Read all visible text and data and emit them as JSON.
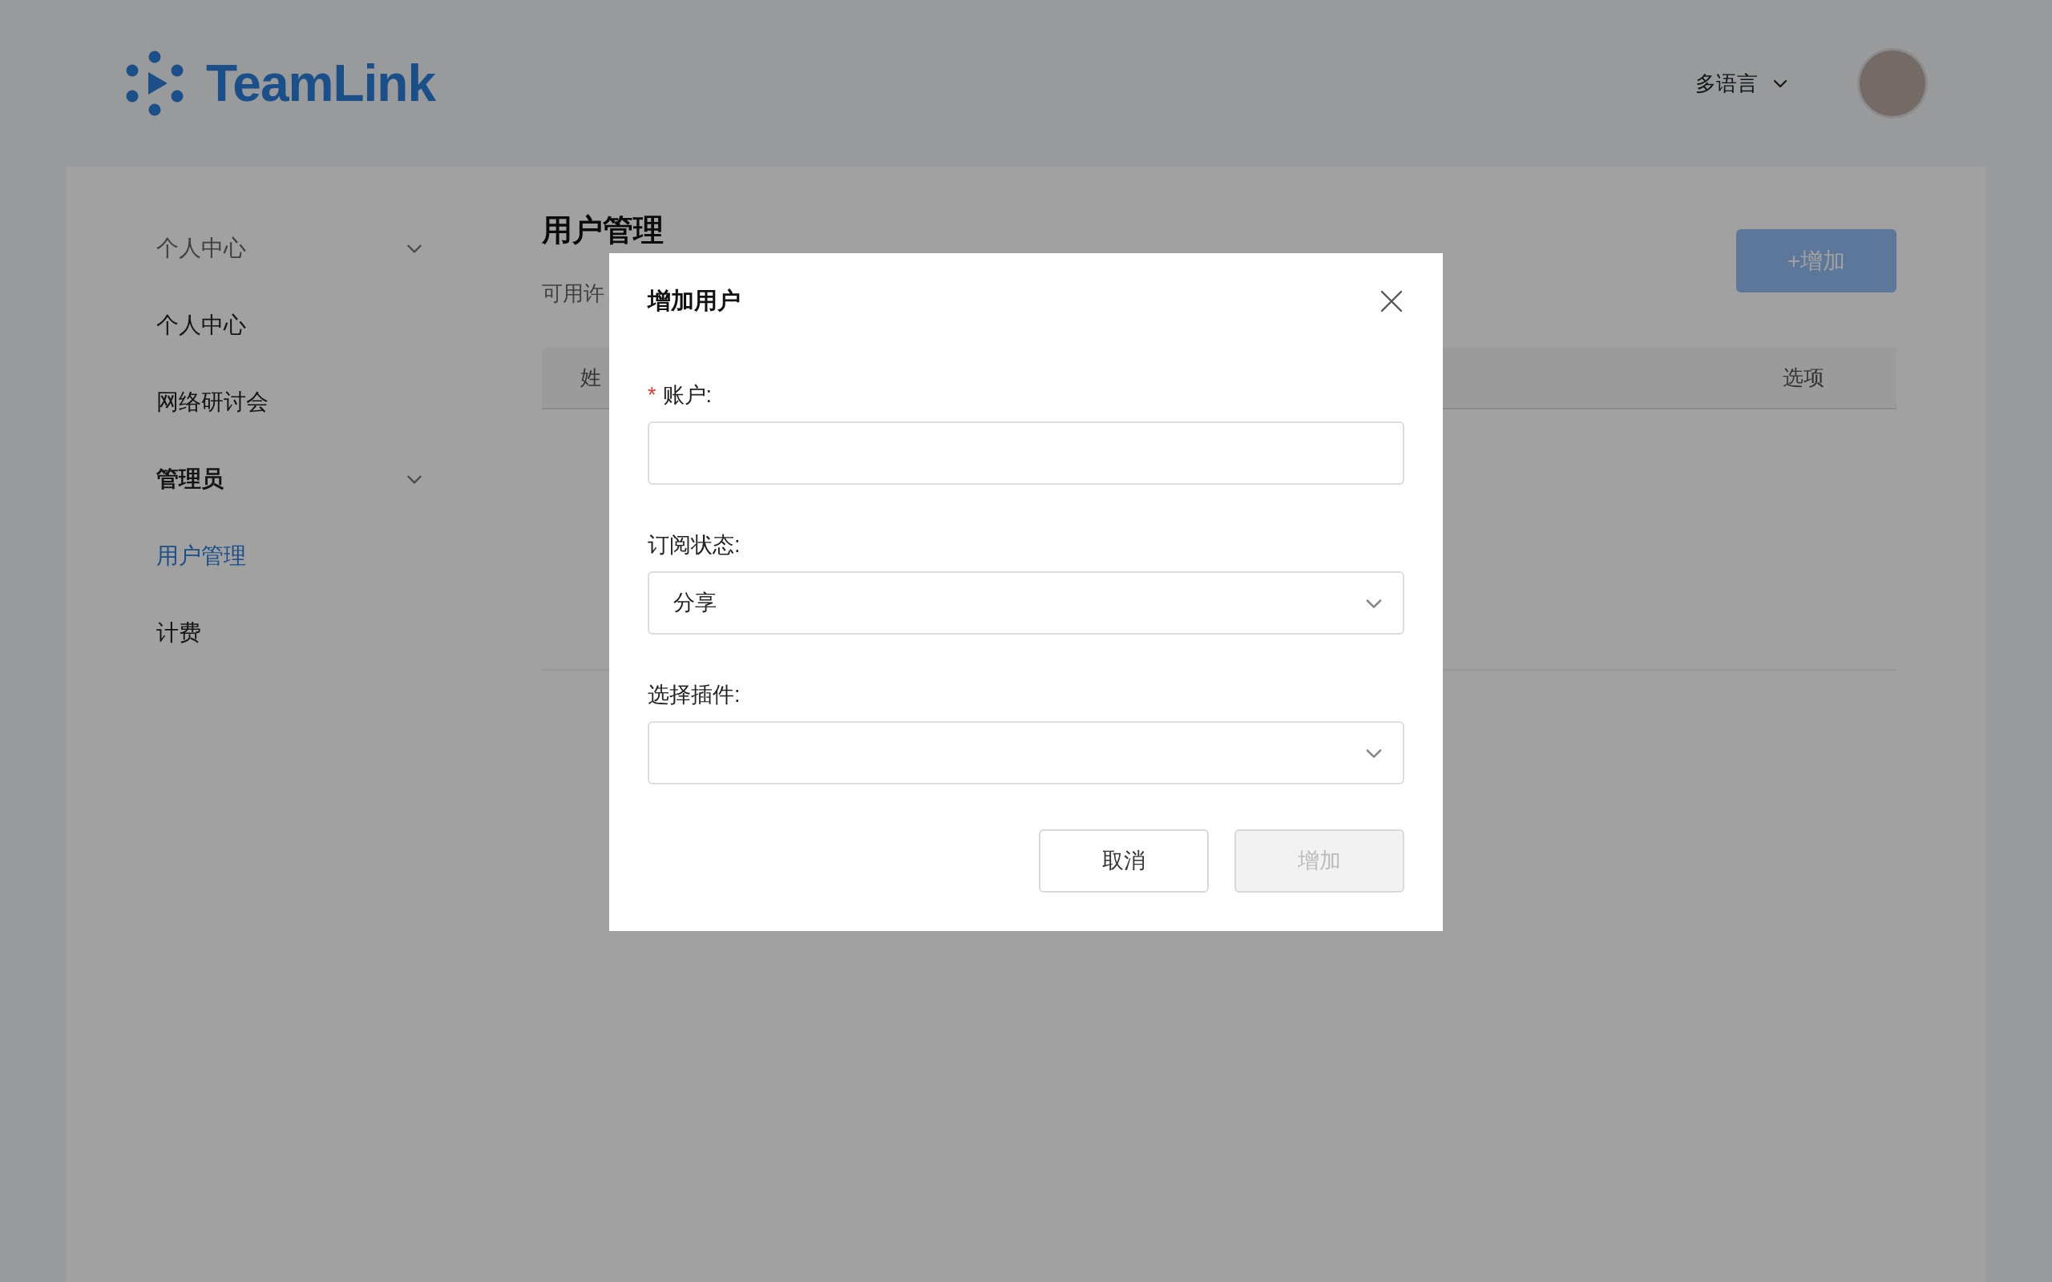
{
  "header": {
    "logo_text": "TeamLink",
    "language": "多语言"
  },
  "sidebar": {
    "groups": [
      {
        "label": "个人中心",
        "active": false,
        "children": [
          {
            "label": "个人中心",
            "selected": false
          },
          {
            "label": "网络研讨会",
            "selected": false
          }
        ]
      },
      {
        "label": "管理员",
        "active": true,
        "children": [
          {
            "label": "用户管理",
            "selected": true
          },
          {
            "label": "计费",
            "selected": false
          }
        ]
      }
    ]
  },
  "page": {
    "title": "用户管理",
    "subtitle": "可用许",
    "add_button": "+增加",
    "table": {
      "columns": [
        "姓",
        "选项"
      ]
    }
  },
  "dialog": {
    "title": "增加用户",
    "fields": [
      {
        "kind": "input",
        "label": "账户:",
        "required_mark": "*"
      },
      {
        "kind": "select",
        "label": "订阅状态:",
        "value": "分享"
      },
      {
        "kind": "select",
        "label": "选择插件:"
      }
    ],
    "buttons": [
      {
        "label": "取消",
        "disabled": false
      },
      {
        "label": "增加",
        "disabled": true
      }
    ]
  }
}
